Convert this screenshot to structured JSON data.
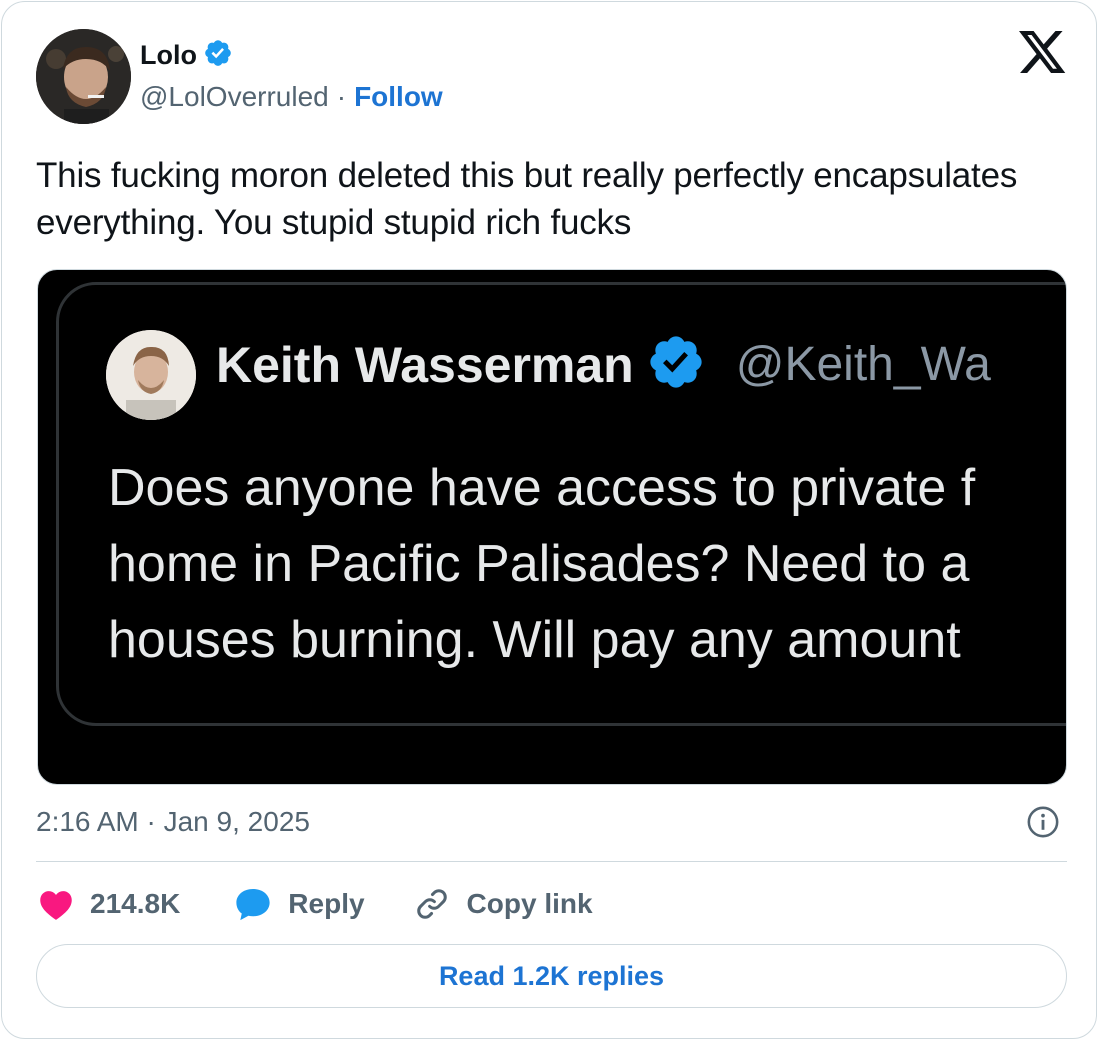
{
  "author": {
    "name": "Lolo",
    "handle": "@LolOverruled",
    "separator": "·",
    "follow_label": "Follow",
    "avatar_icon": "user-photo-avatar"
  },
  "tweet": {
    "text": "This fucking moron deleted this but really perfectly encapsulates everything. You stupid stupid rich fucks",
    "timestamp": "2:16 AM · Jan 9, 2025"
  },
  "quoted_screenshot": {
    "name": "Keith Wasserman",
    "handle": "@Keith_Wa",
    "lines": [
      "Does anyone have access to private f",
      "home in Pacific Palisades? Need to a",
      "houses burning. Will pay any amount"
    ]
  },
  "actions": {
    "likes": "214.8K",
    "reply_label": "Reply",
    "copy_link_label": "Copy link",
    "read_replies_label": "Read 1.2K replies"
  },
  "colors": {
    "verified": "#1d9bf0",
    "link": "#1d74d3",
    "like": "#f91880",
    "reply": "#1d9bf0",
    "muted": "#536471"
  },
  "icons": [
    "verified-badge-icon",
    "x-logo-icon",
    "info-icon",
    "heart-icon",
    "reply-bubble-icon",
    "link-icon"
  ]
}
